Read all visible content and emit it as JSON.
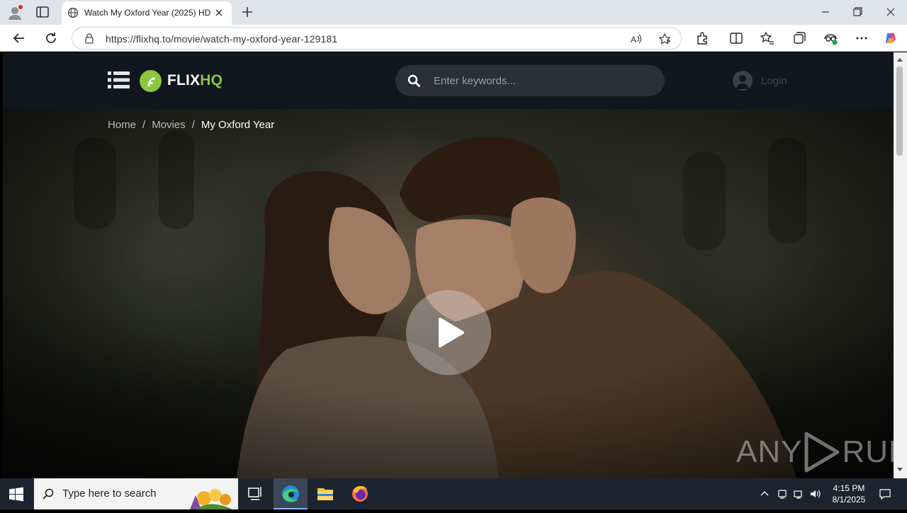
{
  "browser": {
    "tab_title": "Watch My Oxford Year (2025) HD",
    "url": "https://flixhq.to/movie/watch-my-oxford-year-129181"
  },
  "site": {
    "logo_text_main": "FLIX",
    "logo_text_accent": "HQ",
    "search_placeholder": "Enter keywords...",
    "login_label": "Login",
    "breadcrumb": [
      "Home",
      "/",
      "Movies",
      "/",
      "My Oxford Year"
    ]
  },
  "watermark": {
    "left": "ANY",
    "right": "RUN"
  },
  "taskbar": {
    "search_placeholder": "Type here to search",
    "time": "4:15 PM",
    "date": "8/1/2025"
  },
  "colors": {
    "accent": "#8cc63f",
    "header_bg": "#10171f",
    "taskbar_bg": "#1c2430"
  },
  "icons": [
    "profile-icon",
    "tab-actions-icon",
    "globe-icon",
    "close-icon",
    "plus-icon",
    "minimize-icon",
    "maximize-icon",
    "window-close-icon",
    "back-icon",
    "refresh-icon",
    "lock-icon",
    "read-aloud-icon",
    "favorite-star-icon",
    "extensions-icon",
    "split-screen-icon",
    "favorites-icon",
    "collections-icon",
    "browser-essentials-icon",
    "more-icon",
    "copilot-icon",
    "menu-icon",
    "search-icon",
    "user-icon",
    "play-icon",
    "windows-start-icon",
    "task-view-icon",
    "edge-icon",
    "file-explorer-icon",
    "firefox-icon",
    "chevron-up-icon",
    "network-icon",
    "volume-icon",
    "notification-icon"
  ]
}
